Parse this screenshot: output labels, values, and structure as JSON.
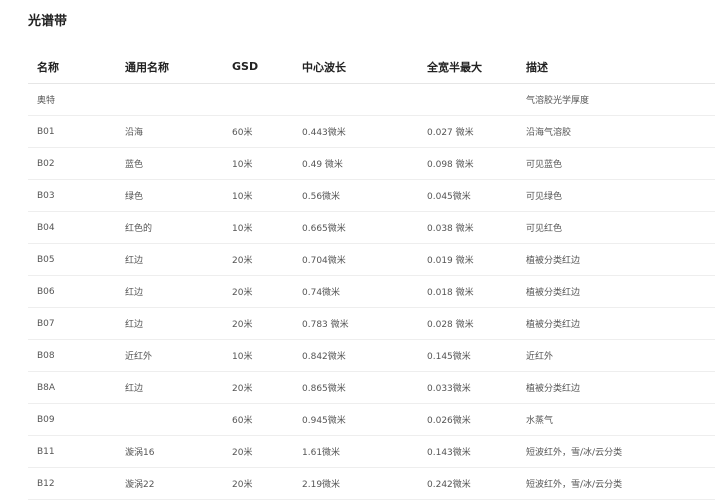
{
  "title": "光谱带",
  "columns": [
    "名称",
    "通用名称",
    "GSD",
    "中心波长",
    "全宽半最大",
    "描述"
  ],
  "rows": [
    [
      "奥特",
      "",
      "",
      "",
      "",
      "气溶胶光学厚度"
    ],
    [
      "B01",
      "沿海",
      "60米",
      "0.443微米",
      "0.027 微米",
      "沿海气溶胶"
    ],
    [
      "B02",
      "蓝色",
      "10米",
      "0.49 微米",
      "0.098 微米",
      "可见蓝色"
    ],
    [
      "B03",
      "绿色",
      "10米",
      "0.56微米",
      "0.045微米",
      "可见绿色"
    ],
    [
      "B04",
      "红色的",
      "10米",
      "0.665微米",
      "0.038 微米",
      "可见红色"
    ],
    [
      "B05",
      "红边",
      "20米",
      "0.704微米",
      "0.019 微米",
      "植被分类红边"
    ],
    [
      "B06",
      "红边",
      "20米",
      "0.74微米",
      "0.018 微米",
      "植被分类红边"
    ],
    [
      "B07",
      "红边",
      "20米",
      "0.783 微米",
      "0.028 微米",
      "植被分类红边"
    ],
    [
      "B08",
      "近红外",
      "10米",
      "0.842微米",
      "0.145微米",
      "近红外"
    ],
    [
      "B8A",
      "红边",
      "20米",
      "0.865微米",
      "0.033微米",
      "植被分类红边"
    ],
    [
      "B09",
      "",
      "60米",
      "0.945微米",
      "0.026微米",
      "水蒸气"
    ],
    [
      "B11",
      "漩涡16",
      "20米",
      "1.61微米",
      "0.143微米",
      "短波红外，雪/冰/云分类"
    ],
    [
      "B12",
      "漩涡22",
      "20米",
      "2.19微米",
      "0.242微米",
      "短波红外，雪/冰/云分类"
    ]
  ]
}
